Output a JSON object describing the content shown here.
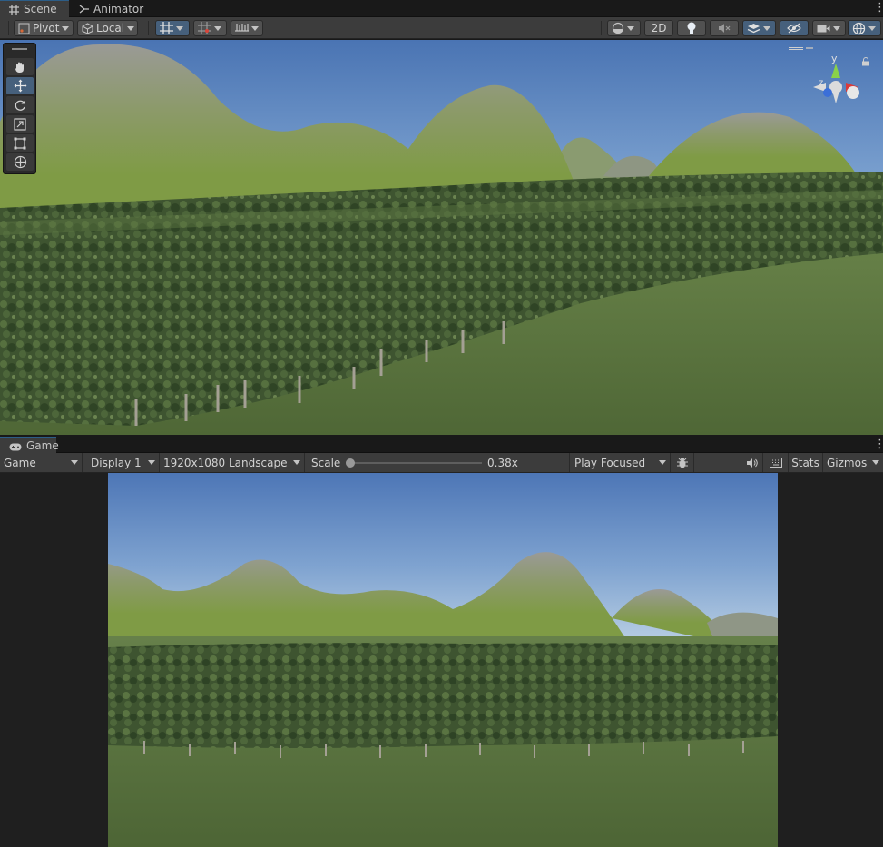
{
  "top_tabs": [
    {
      "label": "Scene",
      "icon": "grid-icon",
      "active": true
    },
    {
      "label": "Animator",
      "icon": "animator-icon",
      "active": false
    }
  ],
  "scene_toolbar": {
    "pivot_label": "Pivot",
    "local_label": "Local",
    "mode_2d_label": "2D"
  },
  "gizmo": {
    "y_label": "y",
    "z_label": "z"
  },
  "game_tab": {
    "label": "Game",
    "icon": "gamepad-icon"
  },
  "game_toolbar": {
    "view_select": "Game",
    "display_select": "Display 1",
    "resolution_select": "1920x1080 Landscape",
    "scale_label": "Scale",
    "scale_value": "0.38x",
    "scale_slider_fraction": 0.0,
    "play_mode_select": "Play Focused",
    "stats_label": "Stats",
    "gizmos_label": "Gizmos"
  },
  "colors": {
    "accent_blue": "#46607c",
    "panel_bg": "#3c3c3c",
    "dark_bg": "#191919",
    "sky_top": "#4f79b8",
    "sky_bottom": "#b9d0e6",
    "hill_green": "#7f9845",
    "tree_green": "#3f5630",
    "ground_green": "#53693a"
  }
}
